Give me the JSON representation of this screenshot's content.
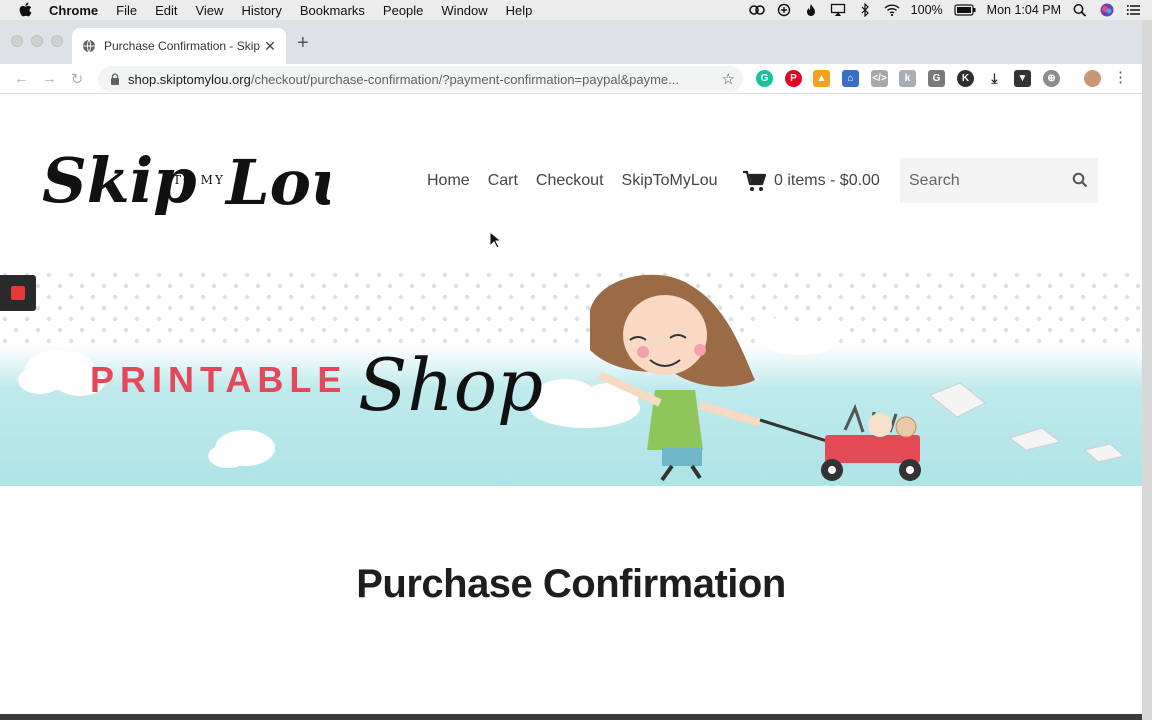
{
  "menubar": {
    "app_name": "Chrome",
    "items": [
      "File",
      "Edit",
      "View",
      "History",
      "Bookmarks",
      "People",
      "Window",
      "Help"
    ],
    "battery": "100%",
    "clock": "Mon 1:04 PM"
  },
  "browser": {
    "tab_title": "Purchase Confirmation - Skip T",
    "url_host": "shop.skiptomylou.org",
    "url_path": "/checkout/purchase-confirmation/?payment-confirmation=paypal&payme..."
  },
  "site": {
    "logo_text_main": "Skip",
    "logo_text_small": "TO MY",
    "logo_text_end": "Lou",
    "nav": [
      "Home",
      "Cart",
      "Checkout",
      "SkipToMyLou"
    ],
    "cart_summary": "0 items - $0.00",
    "search_placeholder": "Search",
    "banner_word1": "PRINTABLE",
    "banner_word2": "Shop",
    "page_title": "Purchase Confirmation"
  },
  "colors": {
    "banner_sky": "#b9eaec",
    "banner_red": "#e4485a",
    "wagon_red": "#e34a55"
  },
  "icons": {
    "cart": "shopping-cart-icon",
    "search": "magnifier-icon",
    "record": "record-stop-icon"
  }
}
